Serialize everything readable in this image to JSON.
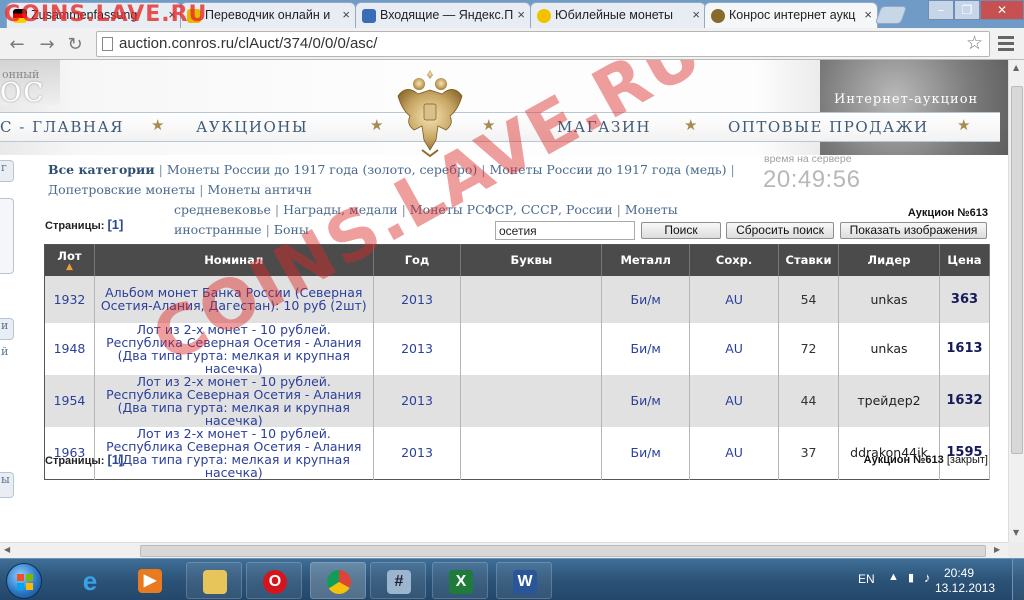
{
  "browser": {
    "tabs": [
      {
        "label": "Zusammenfassung",
        "icon": "flag-icon",
        "color": "#d33a2c"
      },
      {
        "label": "Переводчик онлайн и",
        "icon": "translate-icon",
        "color": "#e6b800"
      },
      {
        "label": "Входящие — Яндекс.П",
        "icon": "mail-icon",
        "color": "#3b6db7"
      },
      {
        "label": "Юбилейные монеты",
        "icon": "smiley-icon",
        "color": "#f2c200"
      },
      {
        "label": "Конрос интернет аукц",
        "icon": "coin-icon",
        "color": "#8a6a2a"
      }
    ],
    "url": "auction.conros.ru/clAuct/374/0/0/0/asc/"
  },
  "watermark": {
    "text": "COINS.LAVE.RU",
    "top_text": "COINS.LAVE.RU"
  },
  "site": {
    "brand_left": "ОС",
    "brand_left_small": "онный",
    "brand_right": "Интернет-аукцион",
    "menu": [
      "С - ГЛАВНАЯ",
      "АУКЦИОНЫ",
      "МАГАЗИН",
      "ОПТОВЫЕ ПРОДАЖИ"
    ],
    "left_stubs": [
      "г",
      "и",
      "й",
      "ы"
    ]
  },
  "categories": {
    "first": "Все категории",
    "line1": [
      "Монеты России до 1917 года (золото, серебро)",
      "Монеты России до 1917 года (медь)",
      "Допетровские монеты",
      "Монеты античн"
    ],
    "line2": [
      "средневековье",
      "Награды, медали",
      "Монеты РСФСР, СССР, России",
      "Монеты иностранные",
      "Боны"
    ]
  },
  "server_time": {
    "label": "время на сервере",
    "value": "20:49:56"
  },
  "auction": {
    "title": "Аукцион №613",
    "bottom_title": "Аукцион №613",
    "bottom_status": "[закрыт]"
  },
  "pagination": {
    "label": "Страницы:",
    "page": "[1]"
  },
  "search": {
    "value": "осетия",
    "search_button": "Поиск",
    "reset_button": "Сбросить поиск",
    "show_images_button": "Показать изображения"
  },
  "table": {
    "headers": [
      "Лот",
      "Номинал",
      "Год",
      "Буквы",
      "Металл",
      "Сохр.",
      "Ставки",
      "Лидер",
      "Цена"
    ],
    "sort_marker": "▲",
    "rows": [
      {
        "lot": "1932",
        "nominal": "Альбом монет Банка России (Северная Осетия-Алания, Дагестан): 10 руб (2шт)",
        "year": "2013",
        "letters": "",
        "metal": "Би/м",
        "grade": "AU",
        "bids": "54",
        "leader": "unkas",
        "price": "363"
      },
      {
        "lot": "1948",
        "nominal": "Лот из 2-х монет - 10 рублей. Республика Северная Осетия - Алания (Два типа гурта: мелкая и крупная насечка)",
        "year": "2013",
        "letters": "",
        "metal": "Би/м",
        "grade": "AU",
        "bids": "72",
        "leader": "unkas",
        "price": "1613"
      },
      {
        "lot": "1954",
        "nominal": "Лот из 2-х монет - 10 рублей. Республика Северная Осетия - Алания (Два типа гурта: мелкая и крупная насечка)",
        "year": "2013",
        "letters": "",
        "metal": "Би/м",
        "grade": "AU",
        "bids": "44",
        "leader": "трейдер2",
        "price": "1632"
      },
      {
        "lot": "1963",
        "nominal": "Лот из 2-х монет - 10 рублей. Республика Северная Осетия - Алания (Два типа гурта: мелкая и крупная насечка)",
        "year": "2013",
        "letters": "",
        "metal": "Би/м",
        "grade": "AU",
        "bids": "37",
        "leader": "ddrakon44ik",
        "price": "1595"
      }
    ]
  },
  "taskbar": {
    "apps": [
      "internet-explorer-icon",
      "media-player-icon",
      "file-explorer-icon",
      "opera-icon",
      "chrome-icon",
      "calculator-icon",
      "excel-icon",
      "word-icon"
    ],
    "language": "EN",
    "time": "20:49",
    "date": "13.12.2013"
  }
}
